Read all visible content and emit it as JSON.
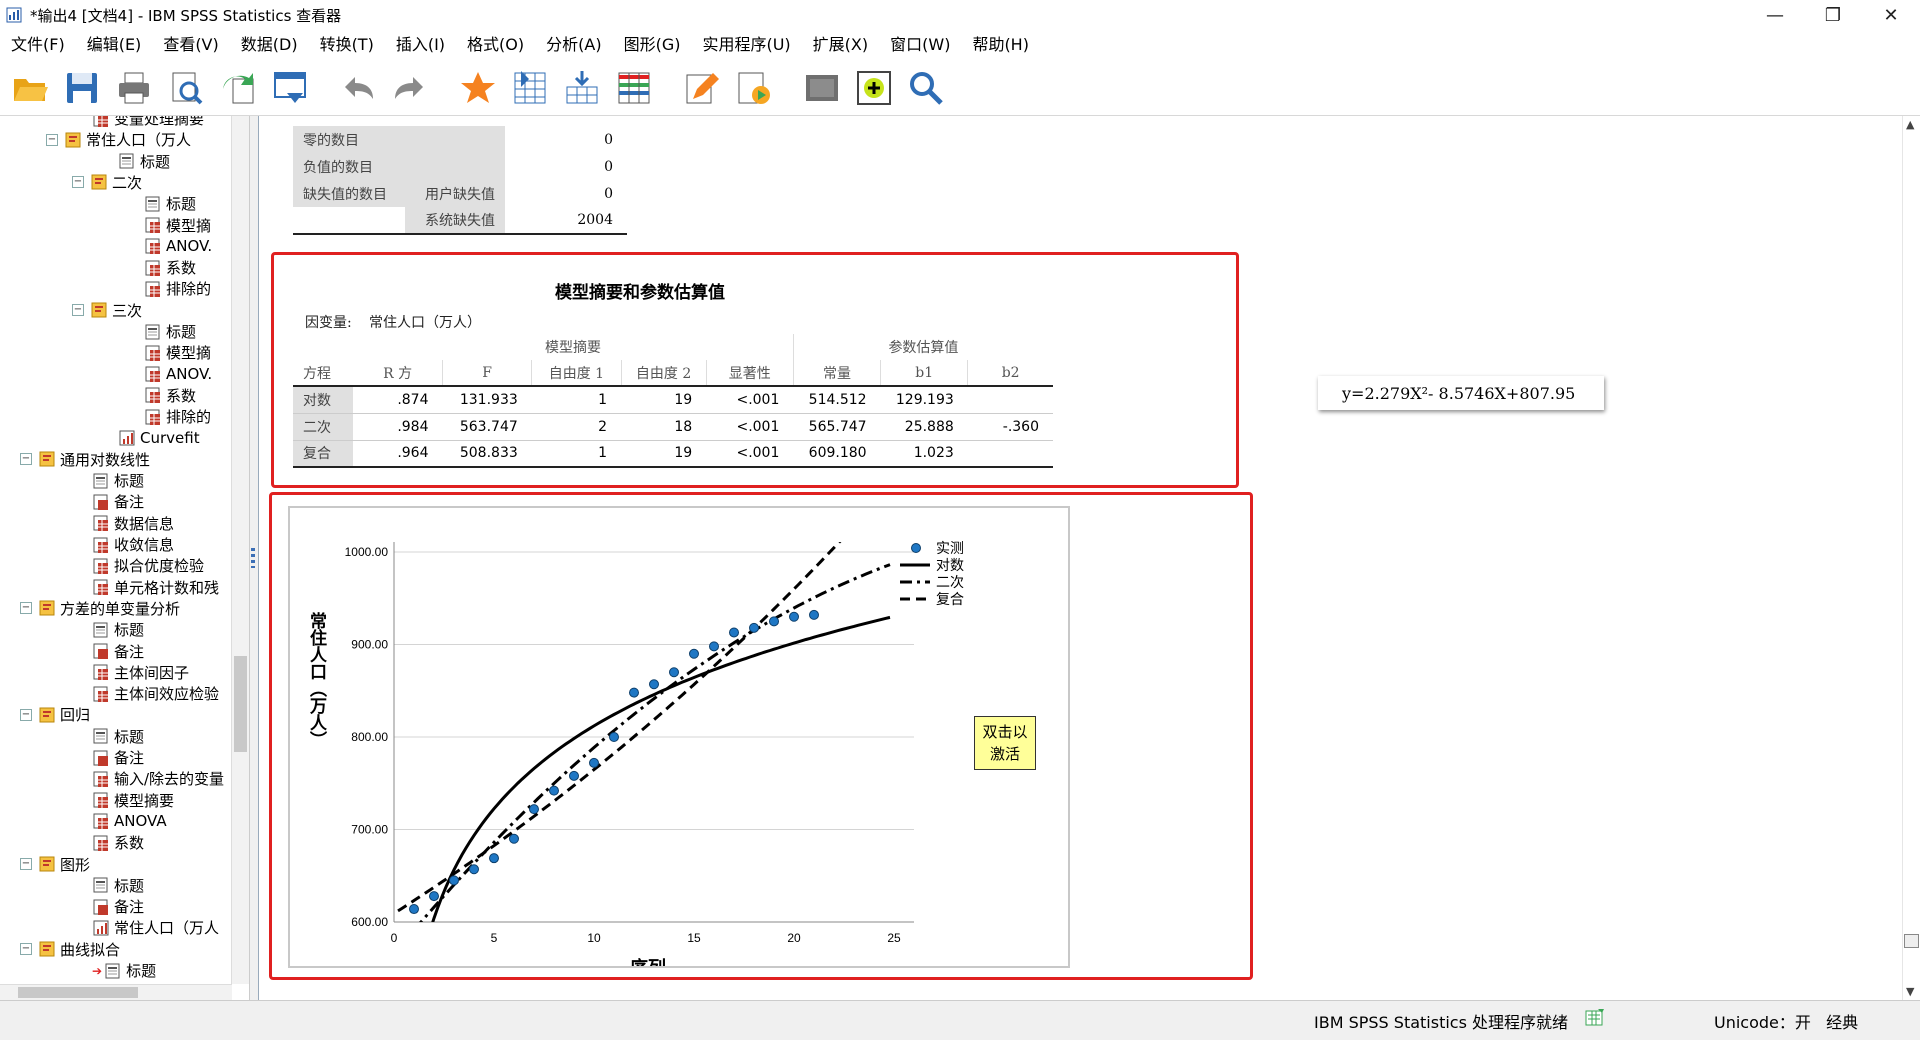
{
  "window": {
    "title": "*输出4 [文档4] - IBM SPSS Statistics 查看器"
  },
  "menu": [
    "文件(F)",
    "编辑(E)",
    "查看(V)",
    "数据(D)",
    "转换(T)",
    "插入(I)",
    "格式(O)",
    "分析(A)",
    "图形(G)",
    "实用程序(U)",
    "扩展(X)",
    "窗口(W)",
    "帮助(H)"
  ],
  "toolbar": [
    "open-icon",
    "save-icon",
    "print-icon",
    "print-preview-icon",
    "export-icon",
    "recall-dialog-icon",
    "undo-icon",
    "redo-icon",
    "goto-data-icon",
    "goto-case-icon",
    "goto-variable-icon",
    "variables-icon",
    "edit-icon",
    "create-edit-autoscript-icon",
    "show-all-icon",
    "designate-window-icon",
    "find-icon"
  ],
  "tree": [
    {
      "label": "变量处理摘要",
      "icon": "table-icon"
    },
    {
      "label": "常住人口（万人",
      "icon": "folder-icon"
    },
    {
      "label": "标题",
      "icon": "title-icon"
    },
    {
      "label": "二次",
      "icon": "folder-icon"
    },
    {
      "label": "标题",
      "icon": "title-icon"
    },
    {
      "label": "模型摘",
      "icon": "table-icon"
    },
    {
      "label": "ANOV.",
      "icon": "table-icon"
    },
    {
      "label": "系数",
      "icon": "table-icon"
    },
    {
      "label": "排除的",
      "icon": "table-icon"
    },
    {
      "label": "三次",
      "icon": "folder-icon"
    },
    {
      "label": "标题",
      "icon": "title-icon"
    },
    {
      "label": "模型摘",
      "icon": "table-icon"
    },
    {
      "label": "ANOV.",
      "icon": "table-icon"
    },
    {
      "label": "系数",
      "icon": "table-icon"
    },
    {
      "label": "排除的",
      "icon": "table-icon"
    },
    {
      "label": "Curvefit",
      "icon": "chart-icon"
    },
    {
      "label": "通用对数线性",
      "icon": "folder-icon"
    },
    {
      "label": "标题",
      "icon": "title-icon"
    },
    {
      "label": "备注",
      "icon": "notes-icon"
    },
    {
      "label": "数据信息",
      "icon": "table-icon"
    },
    {
      "label": "收敛信息",
      "icon": "table-icon"
    },
    {
      "label": "拟合优度检验",
      "icon": "table-icon"
    },
    {
      "label": "单元格计数和残",
      "icon": "table-icon"
    },
    {
      "label": "方差的单变量分析",
      "icon": "folder-icon"
    },
    {
      "label": "标题",
      "icon": "title-icon"
    },
    {
      "label": "备注",
      "icon": "notes-icon"
    },
    {
      "label": "主体间因子",
      "icon": "table-icon"
    },
    {
      "label": "主体间效应检验",
      "icon": "table-icon"
    },
    {
      "label": "回归",
      "icon": "folder-icon"
    },
    {
      "label": "标题",
      "icon": "title-icon"
    },
    {
      "label": "备注",
      "icon": "notes-icon"
    },
    {
      "label": "输入/除去的变量",
      "icon": "table-icon"
    },
    {
      "label": "模型摘要",
      "icon": "table-icon"
    },
    {
      "label": "ANOVA",
      "icon": "table-icon"
    },
    {
      "label": "系数",
      "icon": "table-icon"
    },
    {
      "label": "图形",
      "icon": "folder-icon"
    },
    {
      "label": "标题",
      "icon": "title-icon"
    },
    {
      "label": "备注",
      "icon": "notes-icon"
    },
    {
      "label": "常住人口（万人",
      "icon": "chart-icon"
    },
    {
      "label": "曲线拟合",
      "icon": "folder-icon"
    },
    {
      "label": "标题",
      "icon": "title-icon"
    }
  ],
  "counts_table": {
    "rows": [
      {
        "label": "零的数目",
        "sub": "",
        "value": "0"
      },
      {
        "label": "负值的数目",
        "sub": "",
        "value": "0"
      },
      {
        "label": "缺失值的数目",
        "sub": "用户缺失值",
        "value": "0"
      },
      {
        "label": "",
        "sub": "系统缺失值",
        "value": "2004"
      }
    ]
  },
  "model_summary": {
    "title": "模型摘要和参数估算值",
    "dep_label": "因变量:",
    "dep_value": "常住人口（万人）",
    "group_model": "模型摘要",
    "group_params": "参数估算值",
    "headers": [
      "方程",
      "R 方",
      "F",
      "自由度 1",
      "自由度 2",
      "显著性",
      "常量",
      "b1",
      "b2"
    ],
    "rows": [
      [
        "对数",
        ".874",
        "131.933",
        "1",
        "19",
        "<.001",
        "514.512",
        "129.193",
        ""
      ],
      [
        "二次",
        ".984",
        "563.747",
        "2",
        "18",
        "<.001",
        "565.747",
        "25.888",
        "-.360"
      ],
      [
        "复合",
        ".964",
        "508.833",
        "1",
        "19",
        "<.001",
        "609.180",
        "1.023",
        ""
      ]
    ]
  },
  "equation": "y=2.279X²- 8.5746X+807.95",
  "activate_label": [
    "双击以",
    "激活"
  ],
  "status": {
    "text": "IBM SPSS Statistics 处理程序就绪",
    "unicode": "Unicode：开",
    "mode": "经典"
  },
  "chart_data": {
    "type": "scatter",
    "xlabel": "序列",
    "ylabel": "常住人口（万人）",
    "xlim": [
      0,
      25
    ],
    "ylim": [
      600,
      1000
    ],
    "xticks": [
      "0",
      "5",
      "10",
      "15",
      "20",
      "25"
    ],
    "yticks": [
      "600.00",
      "700.00",
      "800.00",
      "900.00",
      "1000.00"
    ],
    "observed": {
      "name": "实测",
      "x": [
        1,
        2,
        3,
        4,
        5,
        6,
        7,
        8,
        9,
        10,
        11,
        12,
        13,
        14,
        15,
        16,
        17,
        18,
        19,
        20,
        21
      ],
      "y": [
        614,
        628,
        645,
        657,
        669,
        690,
        722,
        742,
        758,
        772,
        800,
        848,
        857,
        870,
        890,
        898,
        913,
        918,
        925,
        930,
        932
      ]
    },
    "legend": [
      "实测",
      "对数",
      "二次",
      "复合"
    ],
    "fits": [
      {
        "name": "对数",
        "style": "solid",
        "b0": 514.512,
        "b1": 129.193,
        "form": "log"
      },
      {
        "name": "二次",
        "style": "dashdot",
        "b0": 565.747,
        "b1": 25.888,
        "b2": -0.36,
        "form": "quadratic"
      },
      {
        "name": "复合",
        "style": "dash",
        "b0": 609.18,
        "b1": 1.023,
        "form": "compound"
      }
    ],
    "grid": true
  }
}
